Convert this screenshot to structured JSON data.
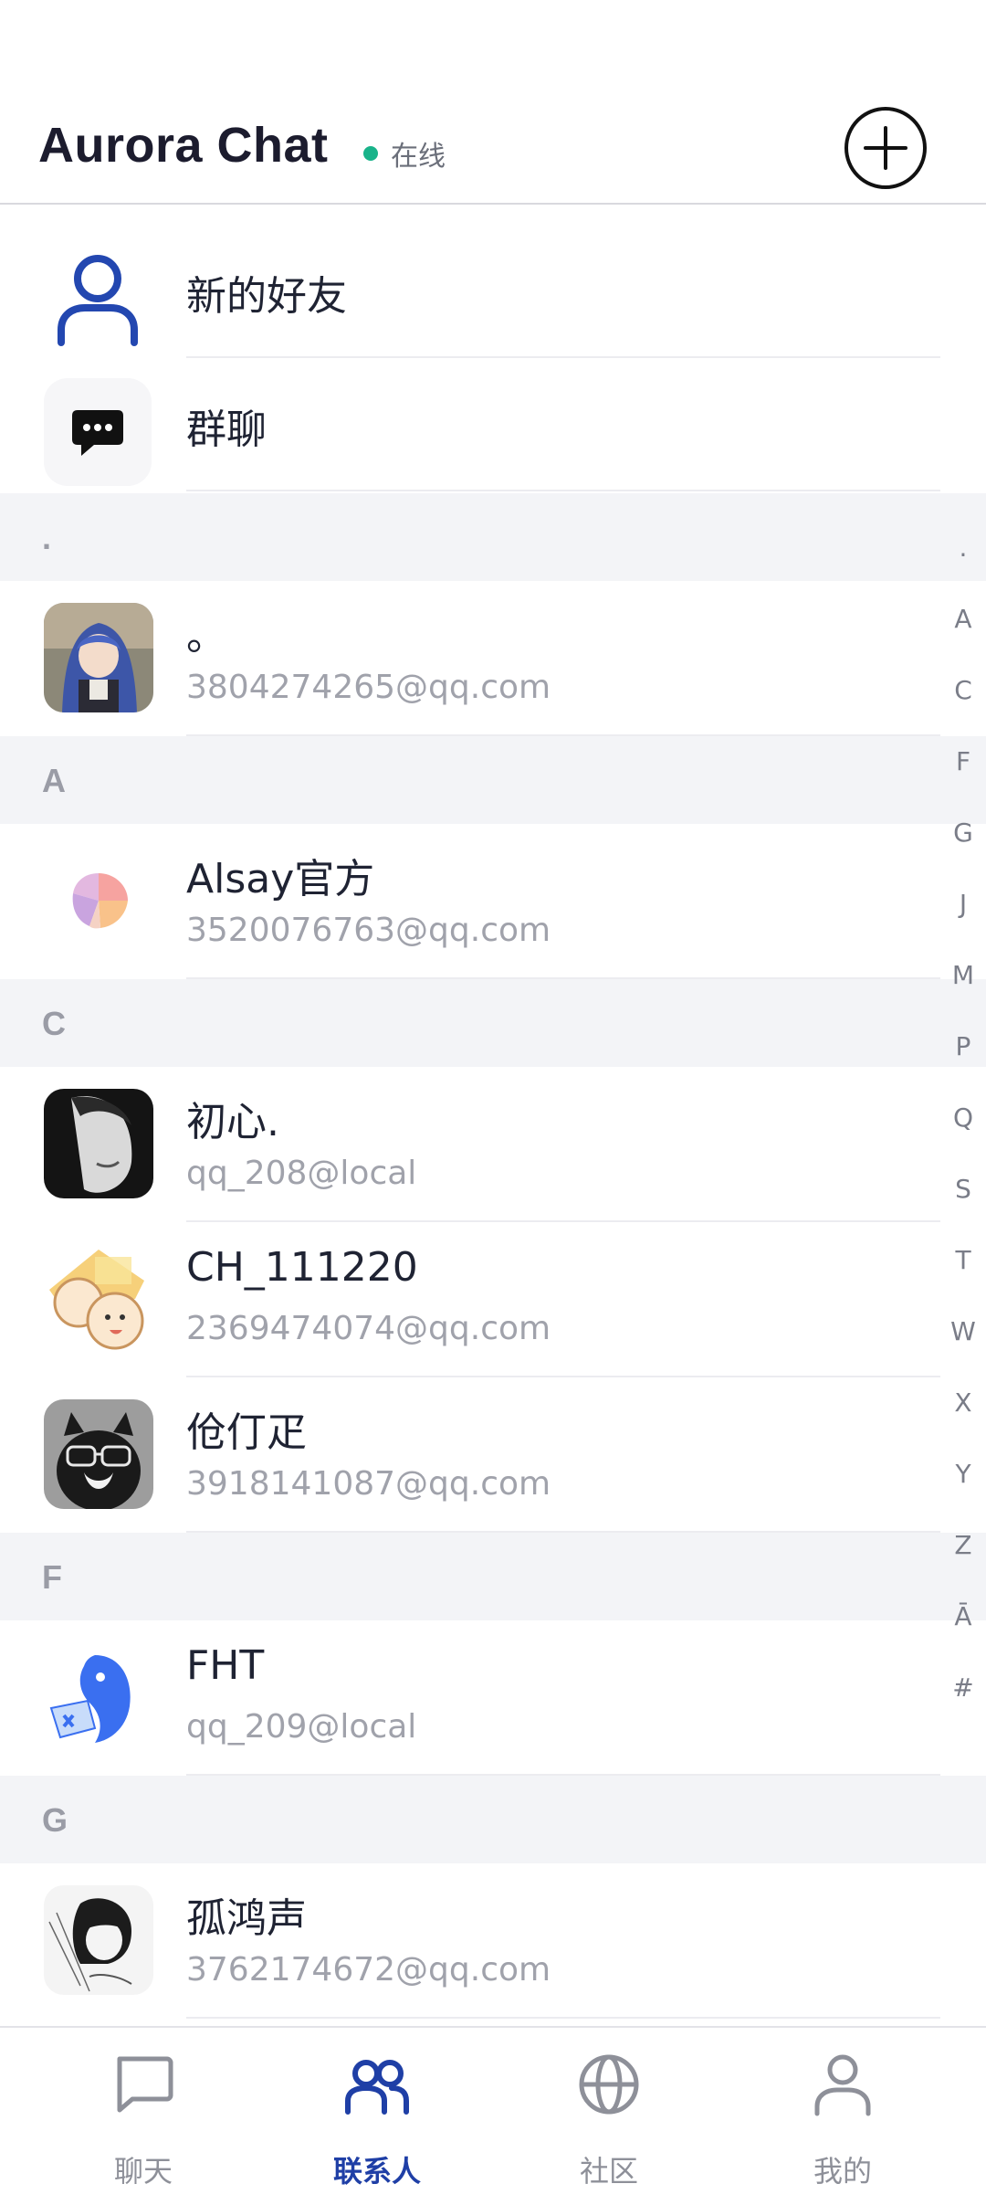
{
  "header": {
    "title": "Aurora Chat",
    "status_text": "在线",
    "status_color": "#19b38a",
    "add_icon": "plus-circle-icon"
  },
  "specials": [
    {
      "label": "新的好友",
      "icon": "user-icon"
    },
    {
      "label": "群聊",
      "icon": "chat-bubble-icon"
    }
  ],
  "sections": [
    {
      "letter": "."
    },
    {
      "letter": "A"
    },
    {
      "letter": "C"
    },
    {
      "letter": "F"
    },
    {
      "letter": "G"
    }
  ],
  "contacts": [
    {
      "name": "。",
      "sub": "3804274265@qq.com"
    },
    {
      "name": "Alsay官方",
      "sub": "3520076763@qq.com"
    },
    {
      "name": "初心.",
      "sub": "qq_208@local"
    },
    {
      "name": "CH_111220",
      "sub": "2369474074@qq.com"
    },
    {
      "name": "伧仃疋",
      "sub": "3918141087@qq.com"
    },
    {
      "name": "FHT",
      "sub": "qq_209@local"
    },
    {
      "name": "孤鸿声",
      "sub": "3762174672@qq.com"
    }
  ],
  "index": [
    ".",
    "A",
    "C",
    "F",
    "G",
    "J",
    "M",
    "P",
    "Q",
    "S",
    "T",
    "W",
    "X",
    "Y",
    "Z",
    "Ā",
    "#"
  ],
  "nav": [
    {
      "label": "聊天",
      "icon": "chat-icon",
      "active": false
    },
    {
      "label": "联系人",
      "icon": "contacts-icon",
      "active": true
    },
    {
      "label": "社区",
      "icon": "globe-icon",
      "active": false
    },
    {
      "label": "我的",
      "icon": "profile-icon",
      "active": false
    }
  ],
  "colors": {
    "accent": "#1f3fa6",
    "section_bg": "#f3f4f7"
  }
}
